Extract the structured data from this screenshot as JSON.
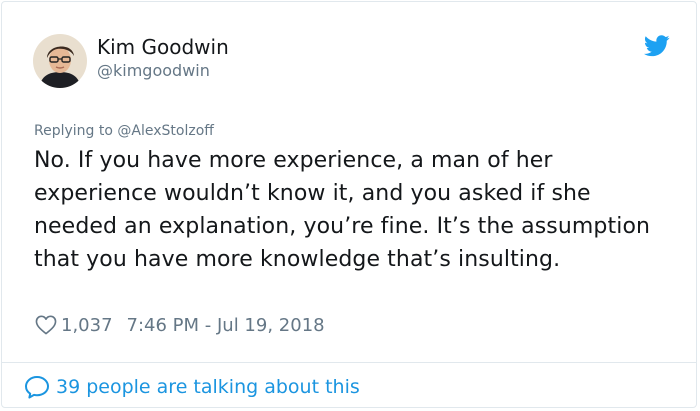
{
  "tweet": {
    "author_name": "Kim Goodwin",
    "author_handle": "@kimgoodwin",
    "replying_prefix": "Replying to",
    "replying_to": "@AlexStolzoff",
    "text": "No. If you have more experience, a man of her experience wouldn’t know it, and you asked if she needed an explanation, you’re fine. It’s the assumption that you have more knowledge that’s insulting.",
    "like_count": "1,037",
    "timestamp": "7:46 PM - Jul 19, 2018"
  },
  "footer": {
    "conversation_text": "39 people are talking about this"
  },
  "icons": {
    "brand": "twitter-bird-icon",
    "like": "heart-icon",
    "conversation": "speech-bubble-icon"
  },
  "colors": {
    "brand_blue": "#1da1f2",
    "link_blue": "#1b95e0",
    "secondary_text": "#657786",
    "primary_text": "#14171a",
    "border": "#e1e8ed"
  }
}
